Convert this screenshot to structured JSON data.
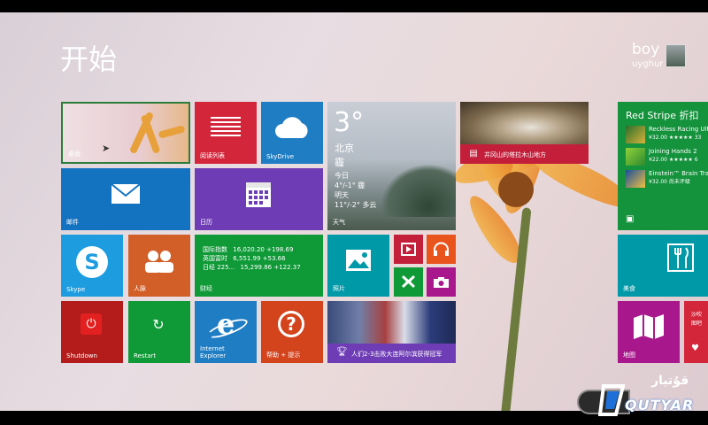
{
  "start": {
    "title": "开始"
  },
  "user": {
    "name": "boy",
    "subtitle": "uyghur"
  },
  "tiles": {
    "desktop": {
      "label": "桌面"
    },
    "reading_list": {
      "label": "阅读列表"
    },
    "skydrive": {
      "label": "SkyDrive"
    },
    "mail": {
      "label": "邮件"
    },
    "calendar": {
      "label": "日历"
    },
    "skype": {
      "label": "Skype"
    },
    "people": {
      "label": "人脉"
    },
    "finance": {
      "label": "财经",
      "rows": [
        {
          "name": "国际指数",
          "value": "16,020.20 +198.69"
        },
        {
          "name": "英国富时",
          "value": "6,551.99 +53.66"
        },
        {
          "name": "日经 225...",
          "value": "15,299.86 +122.37"
        }
      ]
    },
    "photos": {
      "label": "照片"
    },
    "shutdown": {
      "label": "Shutdown"
    },
    "restart": {
      "label": "Restart"
    },
    "ie": {
      "label": "Internet Explorer"
    },
    "help": {
      "label": "帮助 + 提示"
    },
    "news": {
      "label": "人们2-3击败大连阿尔滨获得冠军"
    },
    "weather": {
      "temp": "3°",
      "city": "北京",
      "condition": "霾",
      "today_label": "今日",
      "today_range": "4°/-1° 霾",
      "tomorrow_label": "明天",
      "tomorrow_range": "11°/-2° 多云",
      "label": "天气"
    },
    "travel": {
      "label": "井冈山的塔拉木山地方"
    },
    "store": {
      "title": "Red Stripe 折扣",
      "items": [
        {
          "name": "Reckless Racing Ult",
          "detail": "¥32.00 ★★★★★ 33"
        },
        {
          "name": "Joining Hands 2",
          "detail": "¥22.00 ★★★★★ 6"
        },
        {
          "name": "Einstein™ Brain Trai",
          "detail": "¥32.00 尚未评级"
        }
      ]
    },
    "food": {
      "label": "美食"
    },
    "maps": {
      "label": "地图"
    },
    "partial_right": {
      "line1": "沙吹",
      "line2": "图吧"
    }
  },
  "watermark": {
    "text": "QUTYAR",
    "arabic": "قۇتيار"
  },
  "colors": {
    "desktop_bg": "#e6d3d5",
    "red": "#d4263b",
    "blue": "#1f7dc4",
    "dark_blue": "#1473c0",
    "purple": "#6e3db5",
    "teal": "#0099a8",
    "orange": "#d15f27",
    "green": "#0f9937",
    "dark_red": "#b41b1b",
    "magenta": "#a8188c",
    "store_green": "#14923c",
    "help_orange": "#d3431c"
  }
}
